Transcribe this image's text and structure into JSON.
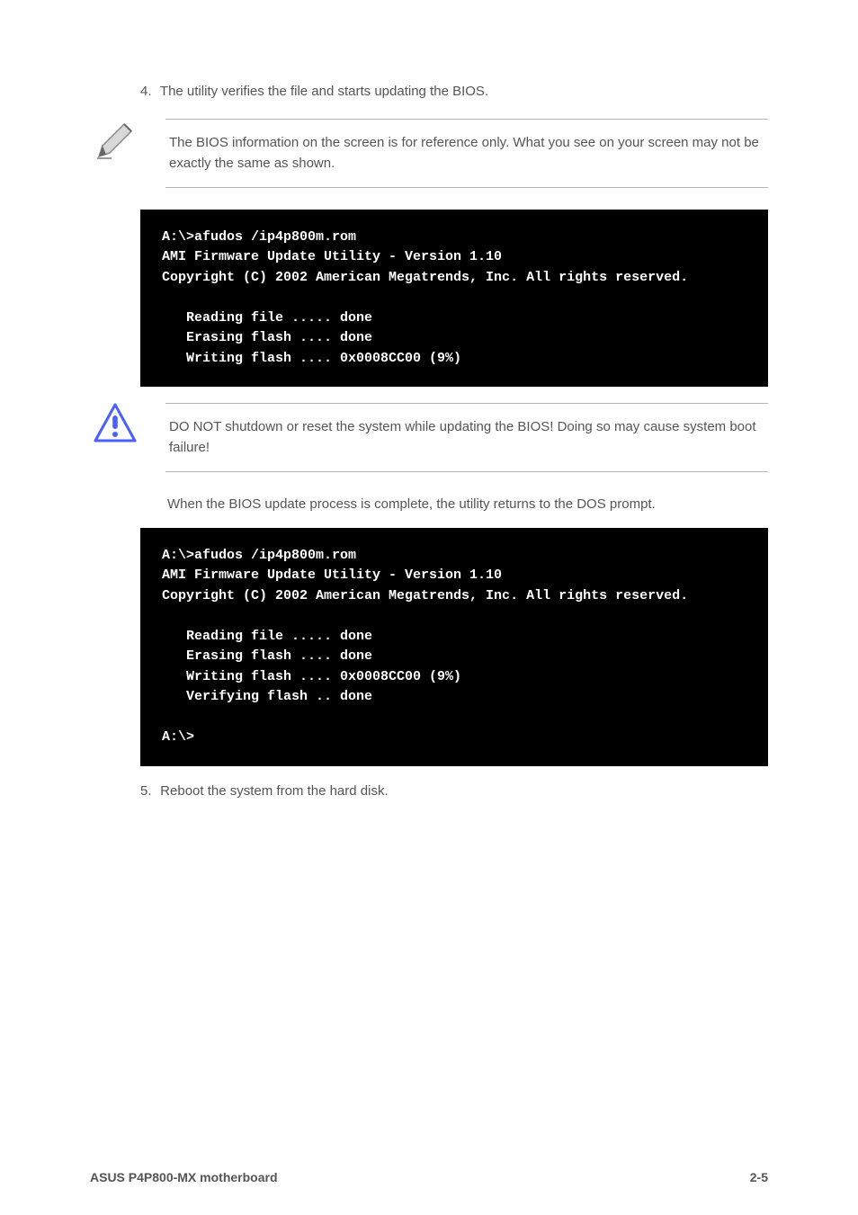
{
  "step4": "The utility verifies the file and starts updating the BIOS.",
  "note_top": "The BIOS information on the screen is for reference only. What you see on your screen may not be exactly the same as shown.",
  "terminal1": {
    "l1": "A:\\>afudos /ip4p800m.rom",
    "l2": "AMI Firmware Update Utility - Version 1.10",
    "l3": "Copyright (C) 2002 American Megatrends, Inc. All rights reserved.",
    "l4": "",
    "l5": "   Reading file ..... done",
    "l6": "   Erasing flash .... done",
    "l7": "   Writing flash .... 0x0008CC00 (9%)"
  },
  "caution": "DO NOT shutdown or reset the system while updating the BIOS! Doing so may cause system boot failure!",
  "mid_para": "When the BIOS update process is complete, the utility returns to the DOS prompt.",
  "terminal2": {
    "l1": "A:\\>afudos /ip4p800m.rom",
    "l2": "AMI Firmware Update Utility - Version 1.10",
    "l3": "Copyright (C) 2002 American Megatrends, Inc. All rights reserved.",
    "l4": "",
    "l5": "   Reading file ..... done",
    "l6": "   Erasing flash .... done",
    "l7": "   Writing flash .... 0x0008CC00 (9%)",
    "l8": "   Verifying flash .. done",
    "l9": "",
    "l10": "A:\\>"
  },
  "step5": "Reboot the system from the hard disk.",
  "footer_left": "ASUS P4P800-MX motherboard",
  "footer_right": "2-5"
}
